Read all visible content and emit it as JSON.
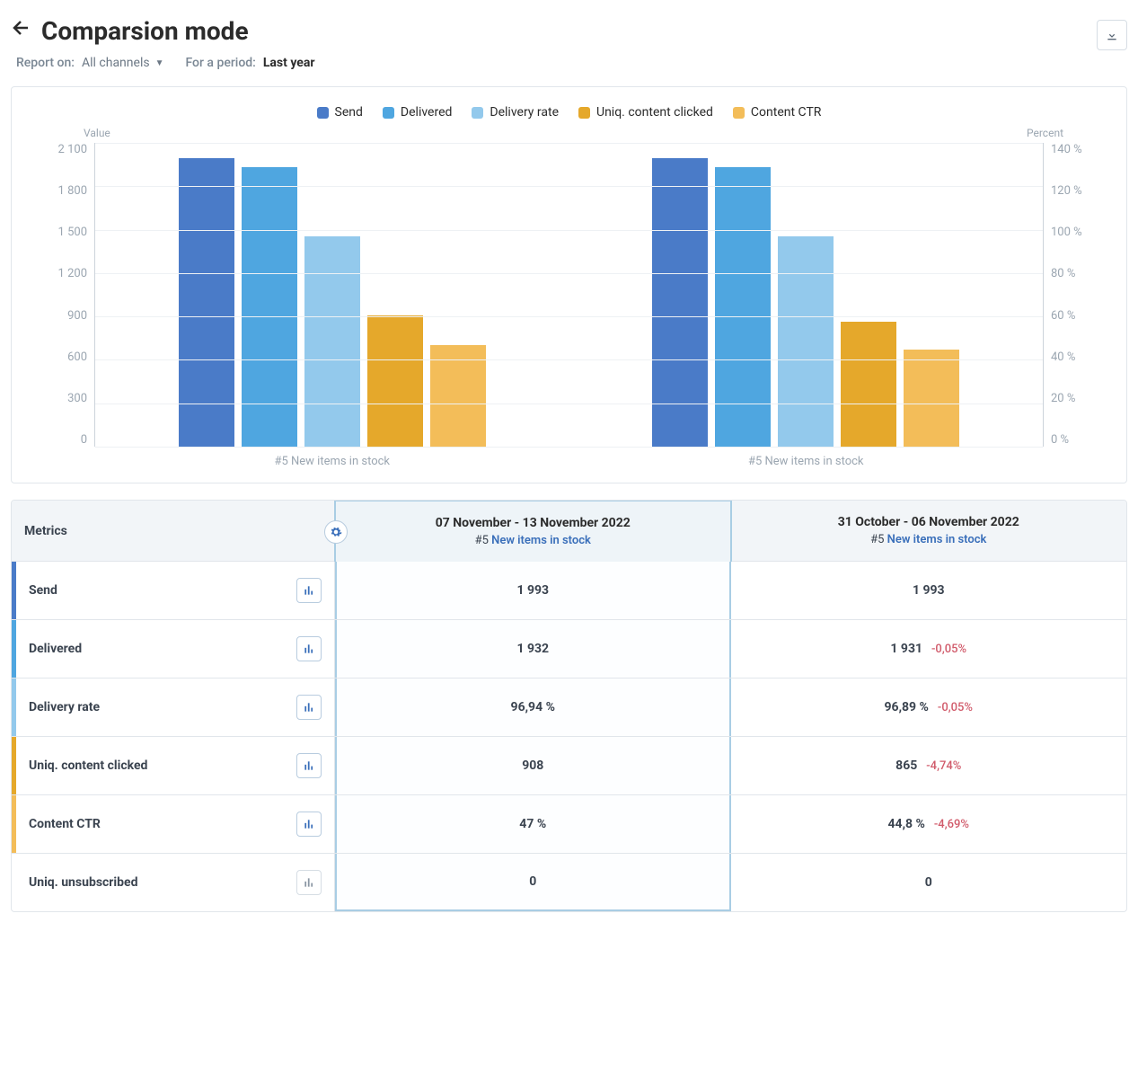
{
  "header": {
    "title": "Comparsion mode"
  },
  "filters": {
    "report_label": "Report on:",
    "report_value": "All channels",
    "period_label": "For a period:",
    "period_value": "Last year"
  },
  "colors": {
    "send": "#4a7bc8",
    "delivered": "#4fa6e0",
    "delivery_rate": "#93c9ec",
    "uniq_clicked": "#e5a82b",
    "content_ctr": "#f3bd59"
  },
  "chart_data": {
    "type": "bar",
    "categories": [
      "#5 New items in stock",
      "#5 New items in stock"
    ],
    "y_left_label": "Value",
    "y_right_label": "Percent",
    "y_left_ticks": [
      "2 100",
      "1 800",
      "1 500",
      "1 200",
      "900",
      "600",
      "300",
      "0"
    ],
    "y_right_ticks": [
      "140 %",
      "120 %",
      "100 %",
      "80 %",
      "60 %",
      "40 %",
      "20 %",
      "0 %"
    ],
    "ylim_left": [
      0,
      2100
    ],
    "ylim_right": [
      0,
      140
    ],
    "series": [
      {
        "name": "Send",
        "axis": "left",
        "color": "#4a7bc8",
        "values": [
          1993,
          1993
        ]
      },
      {
        "name": "Delivered",
        "axis": "left",
        "color": "#4fa6e0",
        "values": [
          1932,
          1931
        ]
      },
      {
        "name": "Delivery rate",
        "axis": "right",
        "color": "#93c9ec",
        "values": [
          96.94,
          96.89
        ]
      },
      {
        "name": "Uniq. content clicked",
        "axis": "left",
        "color": "#e5a82b",
        "values": [
          908,
          865
        ]
      },
      {
        "name": "Content CTR",
        "axis": "right",
        "color": "#f3bd59",
        "values": [
          47.0,
          44.8
        ]
      }
    ]
  },
  "table": {
    "metrics_header": "Metrics",
    "columns": [
      {
        "date": "07 November - 13 November 2022",
        "hash": "#5",
        "campaign": "New items in stock",
        "highlight": true
      },
      {
        "date": "31 October - 06 November 2022",
        "hash": "#5",
        "campaign": "New items in stock",
        "highlight": false
      }
    ],
    "rows": [
      {
        "name": "Send",
        "color": "#4a7bc8",
        "chart_on": true,
        "c0": "1 993",
        "c1": "1 993",
        "delta": ""
      },
      {
        "name": "Delivered",
        "color": "#4fa6e0",
        "chart_on": true,
        "c0": "1 932",
        "c1": "1 931",
        "delta": "-0,05%"
      },
      {
        "name": "Delivery rate",
        "color": "#93c9ec",
        "chart_on": true,
        "c0": "96,94 %",
        "c1": "96,89 %",
        "delta": "-0,05%"
      },
      {
        "name": "Uniq. content clicked",
        "color": "#e5a82b",
        "chart_on": true,
        "c0": "908",
        "c1": "865",
        "delta": "-4,74%"
      },
      {
        "name": "Content CTR",
        "color": "#f3bd59",
        "chart_on": true,
        "c0": "47 %",
        "c1": "44,8 %",
        "delta": "-4,69%"
      },
      {
        "name": "Uniq. unsubscribed",
        "color": "",
        "chart_on": false,
        "c0": "0",
        "c1": "0",
        "delta": ""
      }
    ]
  }
}
